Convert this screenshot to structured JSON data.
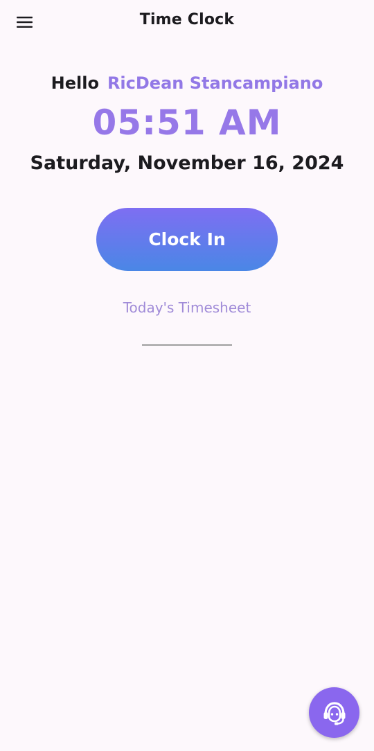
{
  "header": {
    "title": "Time Clock",
    "menu_icon": "hamburger-menu-icon"
  },
  "greeting": {
    "hello": "Hello",
    "user_name": "RicDean Stancampiano"
  },
  "clock": {
    "time": "05:51 AM",
    "date": "Saturday, November 16, 2024"
  },
  "actions": {
    "clock_in_label": "Clock In",
    "timesheet_label": "Today's Timesheet"
  },
  "support_fab": {
    "icon": "support-agent-icon"
  },
  "colors": {
    "accent": "#9278e6",
    "button_gradient_top": "#7e6ef2",
    "button_gradient_bottom": "#4a87e6",
    "fab": "#8a67ee",
    "background": "#fdf8fc"
  }
}
